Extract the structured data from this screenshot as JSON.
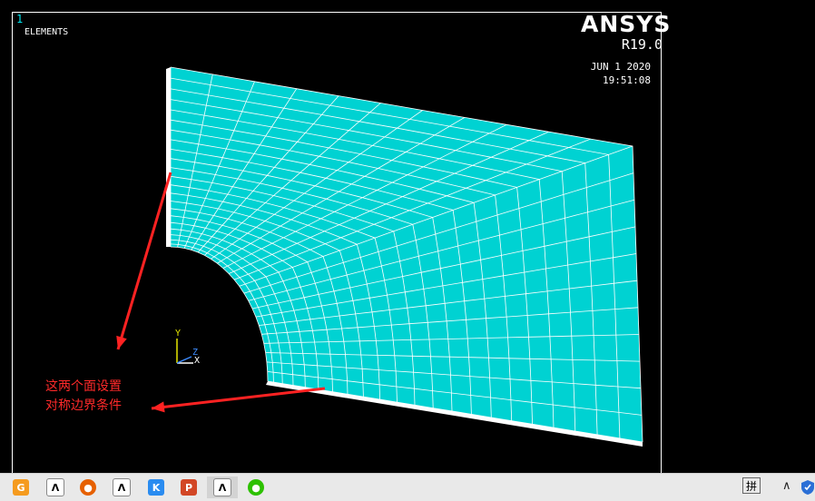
{
  "viewport": {
    "window_number": "1",
    "plot_type": "ELEMENTS",
    "brand": "ANSYS",
    "version": "R19.0",
    "date": "JUN  1 2020",
    "time": "19:51:08",
    "mesh_color": "#00d2d2",
    "mesh_line_color": "#ffffff"
  },
  "annotation": {
    "line1": "这两个面设置",
    "line2": "对称边界条件",
    "color": "#ff2222"
  },
  "triad": {
    "y": "Y",
    "z": "Z",
    "x": "X"
  },
  "taskbar": {
    "apps": [
      {
        "name": "app-g-icon",
        "glyph": "G",
        "color": "#f59b1f"
      },
      {
        "name": "ansys-icon",
        "glyph": "Λ",
        "color": "#ffcc00"
      },
      {
        "name": "firefox-icon",
        "glyph": "●",
        "color": "#e66000"
      },
      {
        "name": "ansys-icon",
        "glyph": "Λ",
        "color": "#ffcc00"
      },
      {
        "name": "app-k-icon",
        "glyph": "K",
        "color": "#2a8cf0"
      },
      {
        "name": "powerpoint-icon",
        "glyph": "P",
        "color": "#d24726"
      },
      {
        "name": "ansys-icon",
        "glyph": "Λ",
        "color": "#ffcc00"
      },
      {
        "name": "wechat-icon",
        "glyph": "●",
        "color": "#2dc100"
      }
    ],
    "ime_label": "拼",
    "tray_arrow": "∧"
  }
}
